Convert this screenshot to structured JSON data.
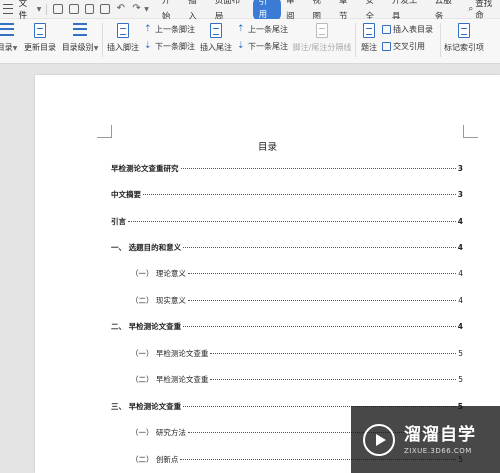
{
  "menubar": {
    "file_label": "文件",
    "tabs": [
      "开始",
      "插入",
      "页面布局",
      "引用",
      "审阅",
      "视图",
      "章节",
      "安全",
      "开发工具",
      "云服务"
    ],
    "active_tab": "引用",
    "search_label": "查找命"
  },
  "ribbon": {
    "toc_label": "目录",
    "update_toc_label": "更新目录",
    "toc_level_label": "目录级别",
    "insert_footnote_label": "插入脚注",
    "prev_footnote_label": "上一条脚注",
    "next_footnote_label": "下一条脚注",
    "insert_endnote_label": "插入尾注",
    "prev_endnote_label": "上一条尾注",
    "next_endnote_label": "下一条尾注",
    "footnote_separator_label": "脚注/尾注分隔线",
    "caption_label": "题注",
    "insert_table_of_figures_label": "插入表目录",
    "cross_reference_label": "交叉引用",
    "mark_index_label": "标记索引项"
  },
  "document": {
    "toc_title": "目录",
    "entries": [
      {
        "text": "早检测论文查重研究",
        "page": "3"
      },
      {
        "text": "中文摘要",
        "page": "3"
      },
      {
        "text": "引言",
        "page": "4"
      },
      {
        "text": "一、 选题目的和意义",
        "page": "4"
      },
      {
        "text": "（一）  理论意义",
        "page": "4"
      },
      {
        "text": "（二）  现实意义",
        "page": "4"
      },
      {
        "text": "二、 早检测论文查重",
        "page": "4"
      },
      {
        "text": "（一）  早检测论文查重",
        "page": "5"
      },
      {
        "text": "（二）  早检测论文查重",
        "page": "5"
      },
      {
        "text": "三、 早检测论文查重",
        "page": "5"
      },
      {
        "text": "（一）  研究方法",
        "page": "5"
      },
      {
        "text": "（二）  创新点",
        "page": "5"
      }
    ]
  },
  "watermark": {
    "main": "溜溜自学",
    "sub": "ZIXUE.3D66.COM"
  }
}
